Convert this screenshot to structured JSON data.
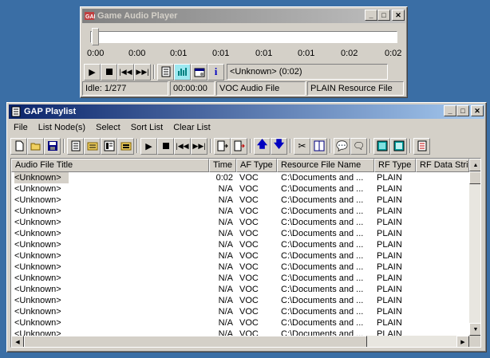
{
  "player": {
    "title": "Game Audio Player",
    "time_ticks": [
      "0:00",
      "0:00",
      "0:01",
      "0:01",
      "0:01",
      "0:01",
      "0:02",
      "0:02"
    ],
    "now_playing": "<Unknown> (0:02)",
    "status": [
      "Idle: 1/277",
      "00:00:00",
      "VOC Audio File",
      "PLAIN Resource File"
    ]
  },
  "playlist": {
    "title": "GAP Playlist",
    "menu": [
      "File",
      "List Node(s)",
      "Select",
      "Sort List",
      "Clear List"
    ],
    "columns": [
      "Audio File Title",
      "Time",
      "AF Type",
      "Resource File Name",
      "RF Type",
      "RF Data Strin"
    ],
    "rows": [
      [
        "<Unknown>",
        "0:02",
        "VOC",
        "C:\\Documents and ...",
        "PLAIN"
      ],
      [
        "<Unknown>",
        "N/A",
        "VOC",
        "C:\\Documents and ...",
        "PLAIN"
      ],
      [
        "<Unknown>",
        "N/A",
        "VOC",
        "C:\\Documents and ...",
        "PLAIN"
      ],
      [
        "<Unknown>",
        "N/A",
        "VOC",
        "C:\\Documents and ...",
        "PLAIN"
      ],
      [
        "<Unknown>",
        "N/A",
        "VOC",
        "C:\\Documents and ...",
        "PLAIN"
      ],
      [
        "<Unknown>",
        "N/A",
        "VOC",
        "C:\\Documents and ...",
        "PLAIN"
      ],
      [
        "<Unknown>",
        "N/A",
        "VOC",
        "C:\\Documents and ...",
        "PLAIN"
      ],
      [
        "<Unknown>",
        "N/A",
        "VOC",
        "C:\\Documents and ...",
        "PLAIN"
      ],
      [
        "<Unknown>",
        "N/A",
        "VOC",
        "C:\\Documents and ...",
        "PLAIN"
      ],
      [
        "<Unknown>",
        "N/A",
        "VOC",
        "C:\\Documents and ...",
        "PLAIN"
      ],
      [
        "<Unknown>",
        "N/A",
        "VOC",
        "C:\\Documents and ...",
        "PLAIN"
      ],
      [
        "<Unknown>",
        "N/A",
        "VOC",
        "C:\\Documents and ...",
        "PLAIN"
      ],
      [
        "<Unknown>",
        "N/A",
        "VOC",
        "C:\\Documents and ...",
        "PLAIN"
      ],
      [
        "<Unknown>",
        "N/A",
        "VOC",
        "C:\\Documents and ...",
        "PLAIN"
      ],
      [
        "<Unknown>",
        "N/A",
        "VOC",
        "C:\\Documents and ...",
        "PLAIN"
      ]
    ]
  }
}
